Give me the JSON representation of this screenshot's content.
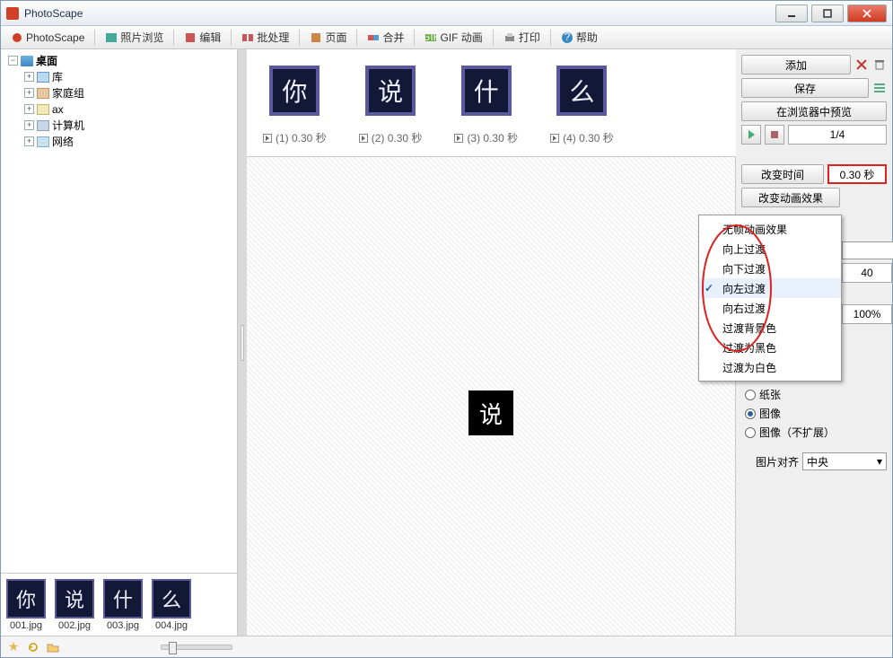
{
  "window": {
    "title": "PhotoScape"
  },
  "toolbar": {
    "items": [
      {
        "label": "PhotoScape",
        "icon": "photoscape-icon"
      },
      {
        "label": "照片浏览",
        "icon": "browse-icon"
      },
      {
        "label": "编辑",
        "icon": "edit-icon"
      },
      {
        "label": "批处理",
        "icon": "batch-icon"
      },
      {
        "label": "页面",
        "icon": "page-icon"
      },
      {
        "label": "合并",
        "icon": "combine-icon"
      },
      {
        "label": "GIF 动画",
        "icon": "gif-icon"
      },
      {
        "label": "打印",
        "icon": "print-icon"
      },
      {
        "label": "帮助",
        "icon": "help-icon"
      }
    ]
  },
  "tree": {
    "root": {
      "label": "桌面"
    },
    "children": [
      {
        "label": "库"
      },
      {
        "label": "家庭组"
      },
      {
        "label": "ax"
      },
      {
        "label": "计算机"
      },
      {
        "label": "网络"
      }
    ]
  },
  "thumbnails": [
    {
      "char": "你",
      "filename": "001.jpg"
    },
    {
      "char": "说",
      "filename": "002.jpg"
    },
    {
      "char": "什",
      "filename": "003.jpg"
    },
    {
      "char": "么",
      "filename": "004.jpg"
    }
  ],
  "frames": [
    {
      "char": "你",
      "label": "(1) 0.30 秒"
    },
    {
      "char": "说",
      "label": "(2) 0.30 秒"
    },
    {
      "char": "什",
      "label": "(3) 0.30 秒"
    },
    {
      "char": "么",
      "label": "(4) 0.30 秒"
    }
  ],
  "preview_char": "说",
  "right": {
    "add": "添加",
    "save": "保存",
    "preview_browser": "在浏览器中预览",
    "frame_counter": "1/4",
    "change_time": "改变时间",
    "time_value": "0.30 秒",
    "change_effect": "改变动画效果",
    "effects": [
      "无帧动画效果",
      "向上过渡",
      "向下过渡",
      "向左过渡",
      "向右过渡",
      "过渡背景色",
      "过渡为黑色",
      "过渡为白色"
    ],
    "selected_effect_index": 3,
    "value_40": "40",
    "value_100pct": "100%",
    "radios": {
      "paper": "纸张",
      "image": "图像",
      "image_noexpand": "图像（不扩展）"
    },
    "selected_radio": "image",
    "align_label": "图片对齐",
    "align_value": "中央"
  }
}
